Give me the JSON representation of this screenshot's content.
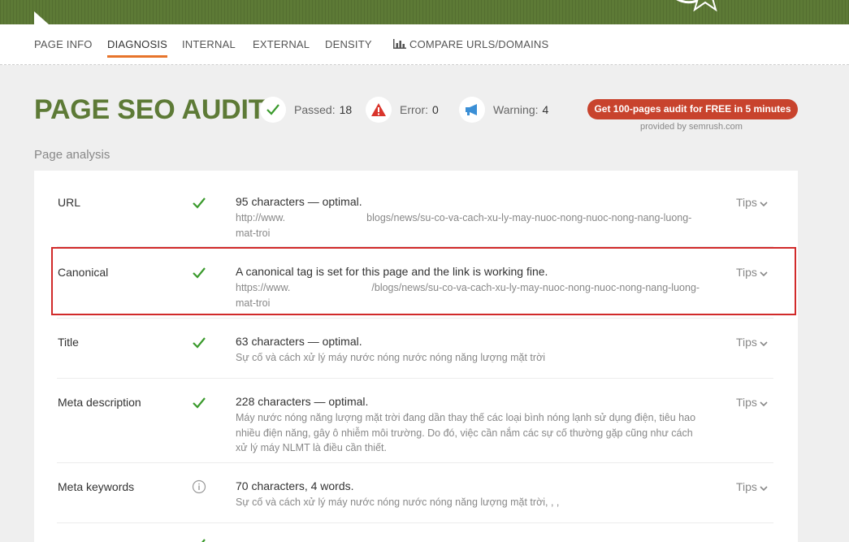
{
  "colors": {
    "brand_green": "#5d7a36",
    "accent_orange": "#e7742b",
    "cta_red": "#c8432d",
    "pass_green": "#3a9a2c",
    "error_red": "#d9342b",
    "warning_blue": "#3b8fd6"
  },
  "nav": {
    "items": [
      {
        "label": "PAGE INFO"
      },
      {
        "label": "DIAGNOSIS"
      },
      {
        "label": "INTERNAL"
      },
      {
        "label": "EXTERNAL"
      },
      {
        "label": "DENSITY"
      },
      {
        "label": "COMPARE URLS/DOMAINS",
        "icon": "bar-chart-icon"
      }
    ],
    "active": "DIAGNOSIS"
  },
  "header": {
    "title": "PAGE SEO AUDIT",
    "passed_label": "Passed:",
    "passed_count": "18",
    "error_label": "Error:",
    "error_count": "0",
    "warning_label": "Warning:",
    "warning_count": "4",
    "cta_label": "Get 100-pages audit for FREE in 5 minutes",
    "provided_by": "provided by  semrush.com"
  },
  "analysis": {
    "section_label": "Page analysis",
    "tips_label": "Tips",
    "rows": [
      {
        "label": "URL",
        "status": "check-icon",
        "message": "95 characters — optimal.",
        "detail_prefix": "http://www.",
        "detail_suffix": "blogs/news/su-co-va-cach-xu-ly-may-nuoc-nong-nuoc-nong-nang-luong-mat-troi"
      },
      {
        "label": "Canonical",
        "status": "check-icon",
        "message": "A canonical tag is set for this page and the link is working fine.",
        "detail_prefix": "https://www.",
        "detail_suffix": "/blogs/news/su-co-va-cach-xu-ly-may-nuoc-nong-nuoc-nong-nang-luong-mat-troi"
      },
      {
        "label": "Title",
        "status": "check-icon",
        "message": "63 characters — optimal.",
        "detail": "Sự cố và cách xử lý máy nước nóng nước nóng năng lượng mặt trời"
      },
      {
        "label": "Meta description",
        "status": "check-icon",
        "message": "228 characters — optimal.",
        "detail": "Máy nước nóng năng lượng mặt trời đang dần thay thế các loại bình nóng lạnh sử dụng điện, tiêu hao nhiều điện năng, gây ô nhiễm môi trường. Do đó, việc cần nắm các sự cố thường gặp cũng như cách xử lý máy NLMT là điều cần thiết."
      },
      {
        "label": "Meta keywords",
        "status": "info-icon",
        "message": "70 characters, 4 words.",
        "detail": "Sự cố và cách xử lý máy nước nóng nước nóng năng lượng mặt trời, , ,"
      }
    ]
  }
}
